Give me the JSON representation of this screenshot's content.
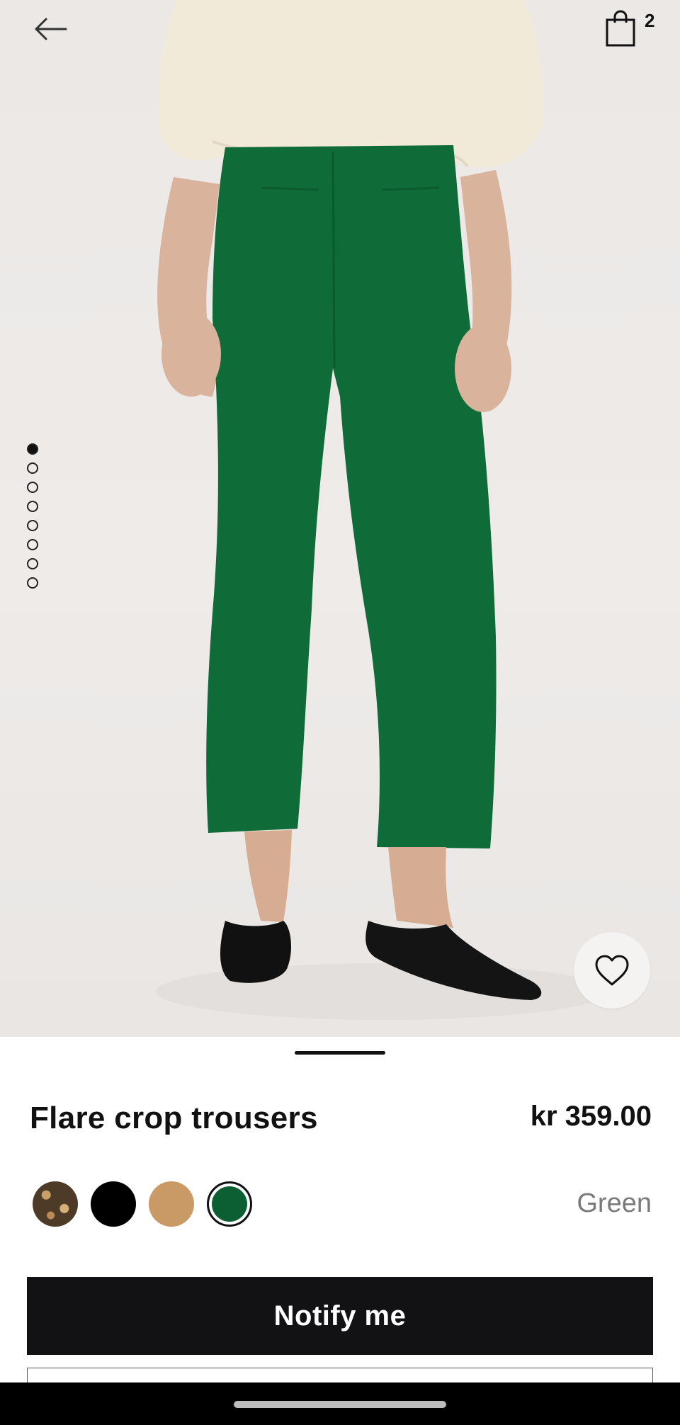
{
  "header": {
    "back_icon": "arrow-left-icon",
    "bag_icon": "shopping-bag-icon",
    "bag_count": "2"
  },
  "gallery": {
    "image_count": 8,
    "active_index": 0,
    "favorite_icon": "heart-outline-icon"
  },
  "product": {
    "title": "Flare crop trousers",
    "price": "kr 359.00",
    "selected_color": "Green",
    "swatches": [
      {
        "name": "patterned-swatch",
        "color": "#6b5236"
      },
      {
        "name": "black-swatch",
        "color": "#000000"
      },
      {
        "name": "camel-swatch",
        "color": "#c99a66"
      },
      {
        "name": "green-swatch",
        "color": "#0c5e33",
        "selected": true
      }
    ]
  },
  "actions": {
    "notify_label": "Notify me"
  },
  "colors": {
    "button_dark": "#121214",
    "product_green": "#0f6b37",
    "muted_text": "#7a7a7a"
  }
}
